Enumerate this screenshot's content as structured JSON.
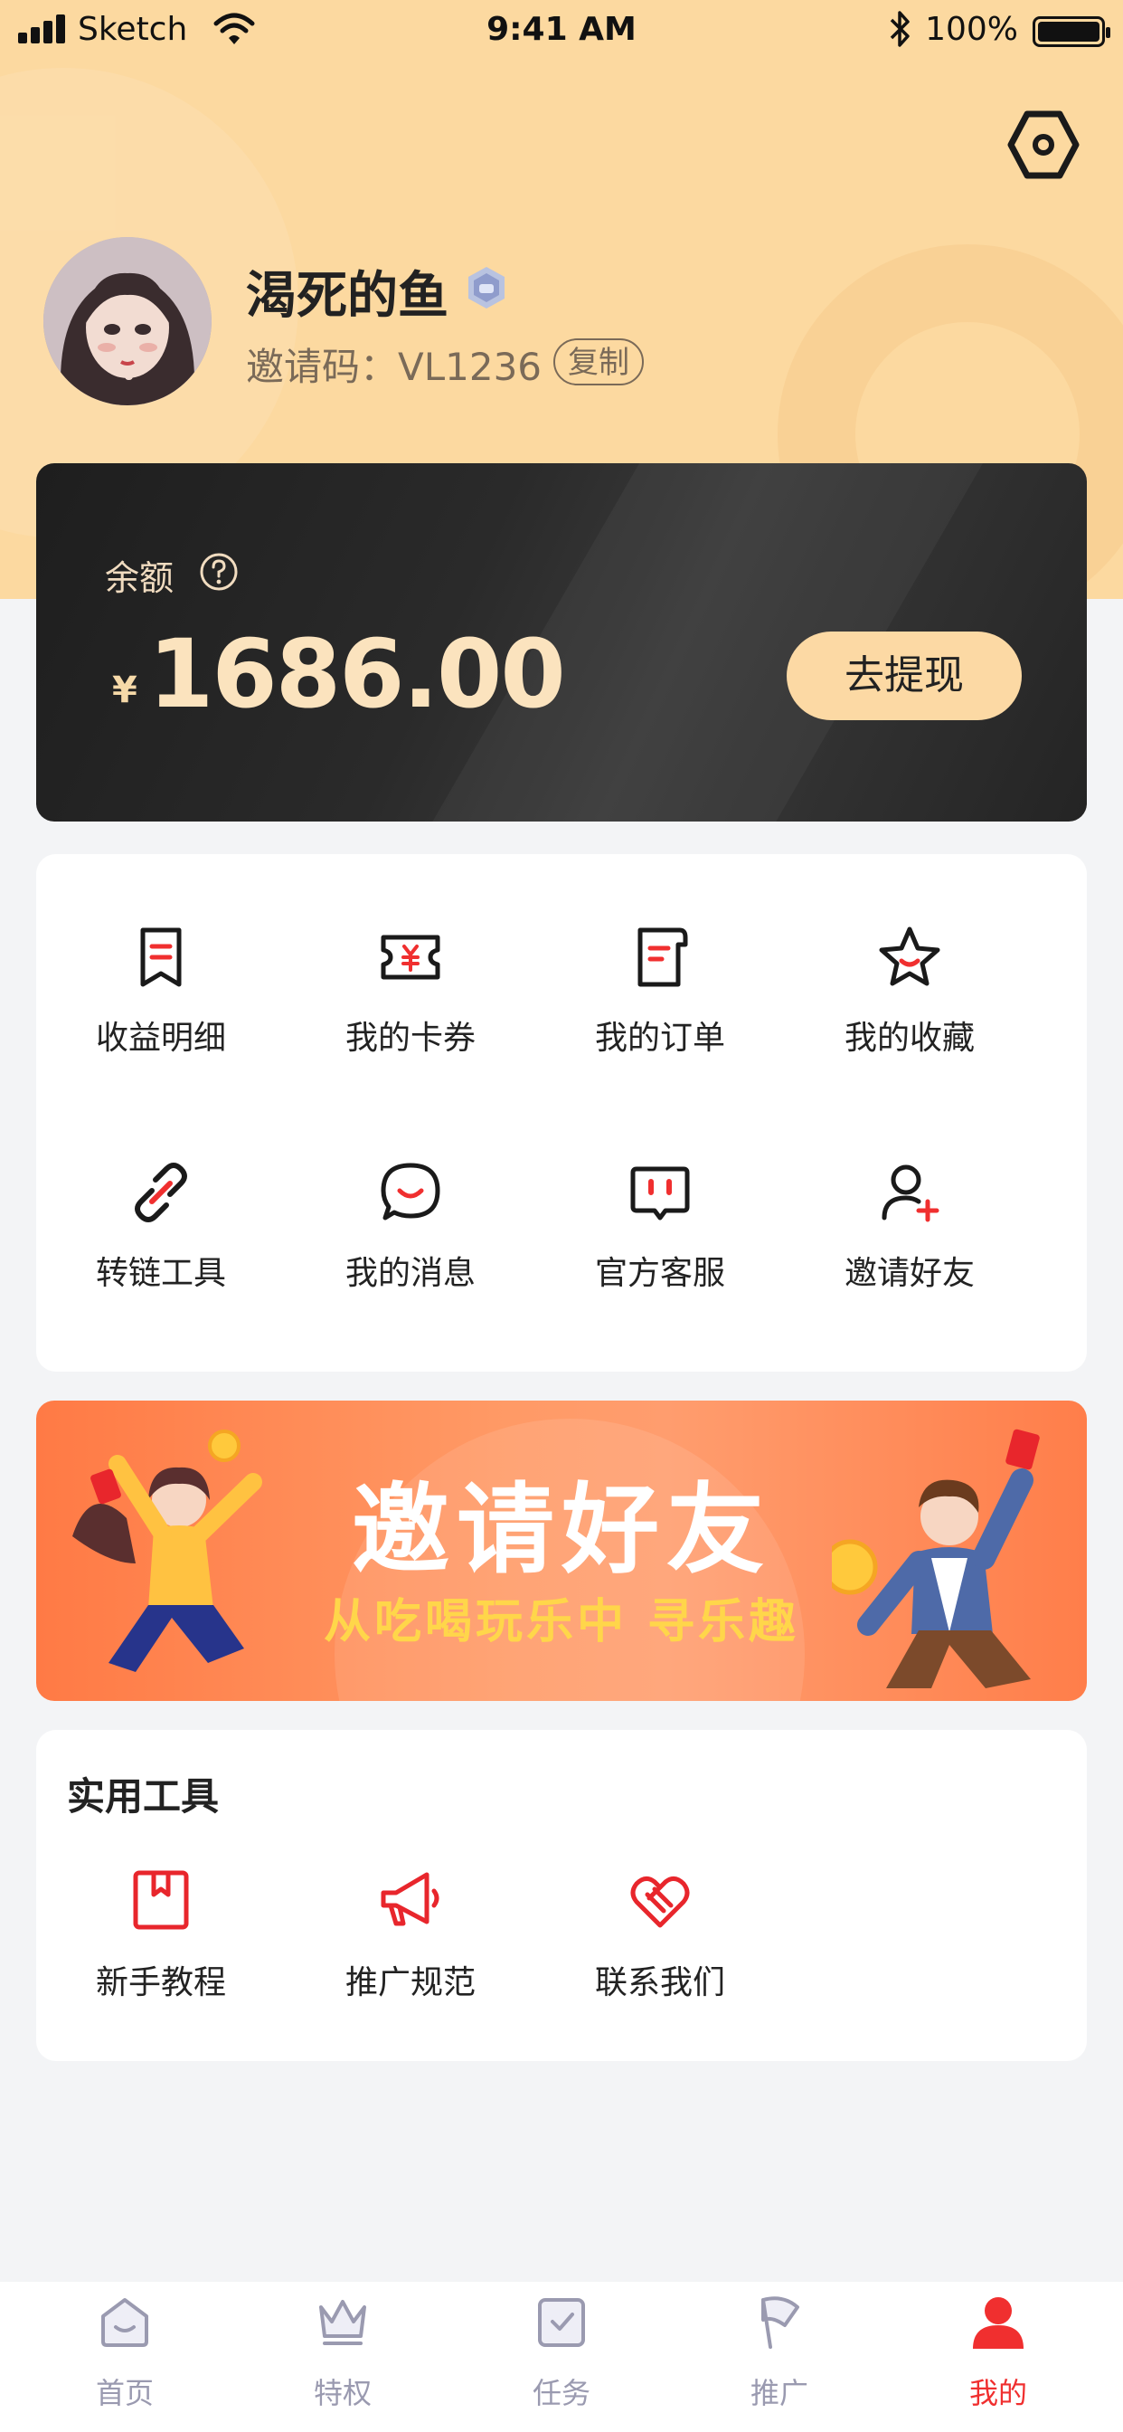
{
  "status_bar": {
    "carrier": "Sketch",
    "time": "9:41 AM",
    "battery": "100%"
  },
  "profile": {
    "username": "渴死的鱼",
    "invite_label": "邀请码：VL1236",
    "copy_label": "复制"
  },
  "balance": {
    "label": "余额",
    "currency": "¥",
    "amount": "1686.00",
    "withdraw_label": "去提现"
  },
  "menu": {
    "items": [
      {
        "label": "收益明细",
        "icon": "income-detail-icon"
      },
      {
        "label": "我的卡券",
        "icon": "coupon-icon"
      },
      {
        "label": "我的订单",
        "icon": "order-icon"
      },
      {
        "label": "我的收藏",
        "icon": "favorite-star-icon"
      },
      {
        "label": "转链工具",
        "icon": "link-icon"
      },
      {
        "label": "我的消息",
        "icon": "message-icon"
      },
      {
        "label": "官方客服",
        "icon": "customer-service-icon"
      },
      {
        "label": "邀请好友",
        "icon": "invite-user-icon"
      }
    ]
  },
  "banner": {
    "title": "邀请好友",
    "subtitle": "从吃喝玩乐中 寻乐趣"
  },
  "tools": {
    "title": "实用工具",
    "items": [
      {
        "label": "新手教程",
        "icon": "tutorial-book-icon"
      },
      {
        "label": "推广规范",
        "icon": "megaphone-icon"
      },
      {
        "label": "联系我们",
        "icon": "handshake-icon"
      }
    ]
  },
  "tabbar": {
    "items": [
      {
        "label": "首页",
        "icon": "home-icon"
      },
      {
        "label": "特权",
        "icon": "crown-icon"
      },
      {
        "label": "任务",
        "icon": "task-check-icon"
      },
      {
        "label": "推广",
        "icon": "flag-icon"
      },
      {
        "label": "我的",
        "icon": "profile-icon"
      }
    ],
    "active_index": 4
  },
  "colors": {
    "header_bg": "#fcd9a0",
    "accent_red": "#f02f2f",
    "card_dark": "#242424",
    "gold": "#fbe3be"
  }
}
